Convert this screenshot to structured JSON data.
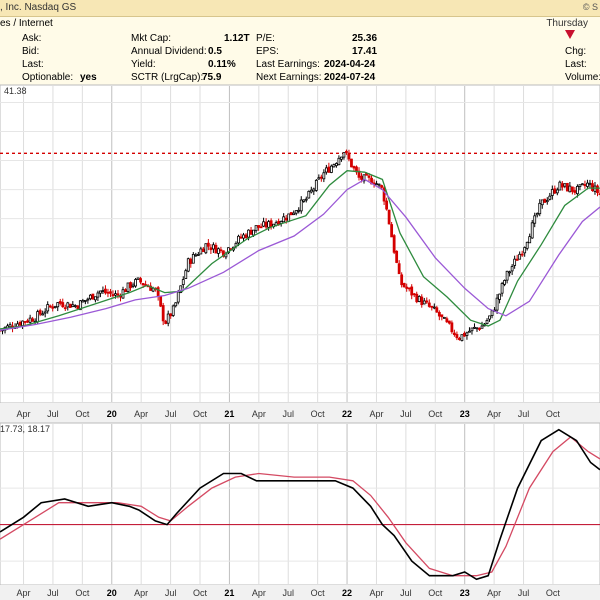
{
  "header": {
    "title_fragment": "es / Internet",
    "exchange_fragment": ", Inc. Nasdaq GS",
    "date_fragment": "Thursday",
    "logo_fragment": "© S",
    "col1": [
      {
        "label": "Ask:",
        "value": ""
      },
      {
        "label": "Bid:",
        "value": ""
      },
      {
        "label": "Last:",
        "value": ""
      },
      {
        "label": "Optionable:",
        "value": "yes"
      }
    ],
    "col2": [
      {
        "label": "Mkt Cap:",
        "value": "1.12T"
      },
      {
        "label": "Annual Dividend:",
        "value": "0.5"
      },
      {
        "label": "Yield:",
        "value": "0.11%"
      },
      {
        "label": "SCTR (LrgCap):",
        "value": "75.9"
      }
    ],
    "col3": [
      {
        "label": "P/E:",
        "value": "25.36"
      },
      {
        "label": "EPS:",
        "value": "17.41"
      },
      {
        "label": "Last Earnings:",
        "value": "2024-04-24"
      },
      {
        "label": "Next Earnings:",
        "value": "2024-07-24"
      }
    ],
    "col4": [
      {
        "label": "Chg:"
      },
      {
        "label": "Last:"
      },
      {
        "label": "Volume:"
      }
    ]
  },
  "chart_data": [
    {
      "type": "line",
      "panel": "price",
      "legend_text": "41.38",
      "x_tick_labels": [
        "Apr",
        "Jul",
        "Oct",
        "20",
        "Apr",
        "Jul",
        "Oct",
        "21",
        "Apr",
        "Jul",
        "Oct",
        "22",
        "Apr",
        "Jul",
        "Oct",
        "23",
        "Apr",
        "Jul",
        "Oct"
      ],
      "x_time_range": [
        2018.8,
        2023.9
      ],
      "y_range": [
        55,
        270
      ],
      "resistance_level": 225,
      "colors": {
        "up": "#000000",
        "down": "#d40000",
        "ma_short": "#2e8b3e",
        "ma_long": "#9b59d6",
        "resistance": "#d40000"
      },
      "series": [
        {
          "name": "",
          "kind": "price",
          "x": [
            2018.8,
            2018.95,
            2019.1,
            2019.2,
            2019.3,
            2019.45,
            2019.55,
            2019.65,
            2019.8,
            2019.92,
            2019.98,
            2020.12,
            2020.2,
            2020.28,
            2020.4,
            2020.55,
            2020.7,
            2020.85,
            2020.98,
            2021.1,
            2021.25,
            2021.4,
            2021.55,
            2021.65,
            2021.72,
            2021.85,
            2021.98,
            2022.05,
            2022.1,
            2022.2,
            2022.35,
            2022.5,
            2022.7,
            2022.8,
            2022.9,
            2022.98,
            2023.1,
            2023.25,
            2023.4,
            2023.55,
            2023.7,
            2023.8,
            2023.9
          ],
          "y": [
            103,
            108,
            112,
            118,
            122,
            120,
            125,
            130,
            127,
            135,
            137,
            131,
            108,
            118,
            150,
            162,
            157,
            167,
            174,
            176,
            182,
            193,
            211,
            219,
            227,
            208,
            206,
            200,
            181,
            136,
            125,
            116,
            98,
            103,
            106,
            114,
            140,
            160,
            190,
            203,
            199,
            204,
            197
          ]
        },
        {
          "name": "",
          "kind": "ma_short",
          "x": [
            2018.8,
            2019.0,
            2019.3,
            2019.6,
            2019.9,
            2020.05,
            2020.2,
            2020.35,
            2020.6,
            2020.9,
            2021.1,
            2021.4,
            2021.6,
            2021.75,
            2021.9,
            2022.05,
            2022.2,
            2022.4,
            2022.6,
            2022.8,
            2022.95,
            2023.05,
            2023.2,
            2023.4,
            2023.6,
            2023.8,
            2023.9
          ],
          "y": [
            104,
            106,
            113,
            121,
            129,
            134,
            129,
            130,
            149,
            166,
            174,
            182,
            203,
            213,
            212,
            207,
            170,
            140,
            126,
            110,
            106,
            110,
            137,
            162,
            189,
            201,
            201
          ]
        },
        {
          "name": "",
          "kind": "ma_long",
          "x": [
            2018.8,
            2019.1,
            2019.4,
            2019.7,
            2019.95,
            2020.2,
            2020.4,
            2020.7,
            2021.0,
            2021.3,
            2021.55,
            2021.75,
            2021.9,
            2022.05,
            2022.25,
            2022.5,
            2022.75,
            2022.95,
            2023.1,
            2023.3,
            2023.55,
            2023.75,
            2023.9
          ],
          "y": [
            103,
            107,
            112,
            118,
            124,
            127,
            132,
            143,
            158,
            168,
            183,
            200,
            207,
            200,
            181,
            153,
            132,
            118,
            113,
            123,
            155,
            178,
            188
          ]
        }
      ]
    },
    {
      "type": "line",
      "panel": "oscillator",
      "legend_text": "17.73, 18.17",
      "x_time_range": [
        2018.8,
        2023.9
      ],
      "y_range": [
        -16,
        27
      ],
      "zero_line": 0,
      "colors": {
        "line1": "#000000",
        "line2": "#d44a63",
        "zero": "#c41e3a"
      },
      "series": [
        {
          "name": "",
          "kind": "line1",
          "x": [
            2018.8,
            2019.0,
            2019.15,
            2019.35,
            2019.55,
            2019.75,
            2019.9,
            2019.98,
            2020.12,
            2020.22,
            2020.3,
            2020.5,
            2020.7,
            2020.85,
            2020.98,
            2021.2,
            2021.45,
            2021.65,
            2021.8,
            2021.95,
            2022.05,
            2022.15,
            2022.3,
            2022.45,
            2022.65,
            2022.75,
            2022.85,
            2022.95,
            2023.05,
            2023.2,
            2023.4,
            2023.55,
            2023.7,
            2023.82,
            2023.9
          ],
          "y": [
            -2,
            2,
            6,
            7,
            5,
            6,
            5,
            4,
            1,
            0,
            3,
            10,
            14,
            14,
            12,
            12,
            12,
            12,
            10,
            5,
            0,
            -3,
            -10,
            -14,
            -14,
            -13,
            -15,
            -14,
            -4,
            10,
            23,
            26,
            23,
            17,
            15
          ]
        },
        {
          "name": "",
          "kind": "line2",
          "x": [
            2018.8,
            2019.1,
            2019.3,
            2019.55,
            2019.8,
            2020.0,
            2020.15,
            2020.25,
            2020.4,
            2020.6,
            2020.8,
            2021.0,
            2021.3,
            2021.6,
            2021.8,
            2021.95,
            2022.1,
            2022.25,
            2022.45,
            2022.65,
            2022.85,
            2022.98,
            2023.1,
            2023.3,
            2023.5,
            2023.65,
            2023.8,
            2023.9
          ],
          "y": [
            -4,
            2,
            6,
            6,
            6,
            5,
            2,
            1,
            5,
            10,
            13,
            14,
            13,
            13,
            12,
            8,
            2,
            -5,
            -12,
            -14,
            -14,
            -13,
            -6,
            10,
            20,
            24,
            20,
            18
          ]
        }
      ]
    }
  ]
}
